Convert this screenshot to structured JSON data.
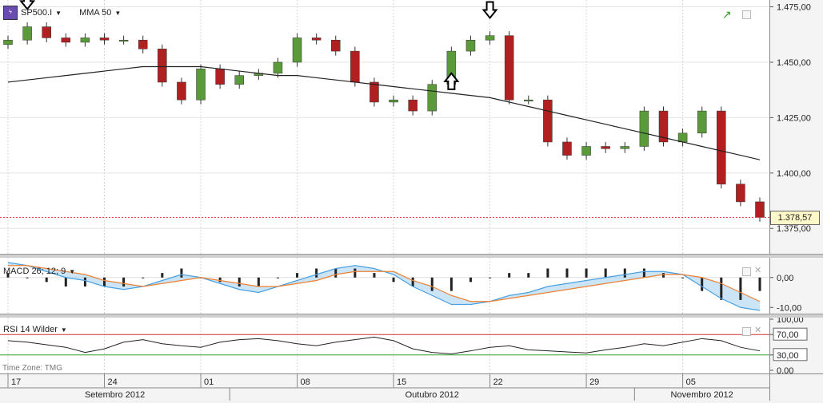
{
  "main_chart": {
    "symbol": "SP500.I",
    "indicator": "MMA 50",
    "last_price_label": "1.378,57",
    "y_ticks": [
      "1.475,00",
      "1.450,00",
      "1.425,00",
      "1.400,00",
      "1.375,00"
    ]
  },
  "macd": {
    "label": "MACD 26; 12; 9",
    "y_ticks": [
      "0,00",
      "-10,00"
    ]
  },
  "rsi": {
    "label": "RSI 14 Wilder",
    "y_ticks": [
      "100,00",
      "70,00",
      "30,00",
      "0,00"
    ]
  },
  "timezone_label": "Time Zone: TMG",
  "date_axis": {
    "day_ticks": [
      "17",
      "24",
      "01",
      "08",
      "15",
      "22",
      "29",
      "05"
    ],
    "months": [
      "Setembro 2012",
      "Outubro 2012",
      "Novembro 2012"
    ]
  },
  "colors": {
    "up_candle": "#5a9a3a",
    "down_candle": "#b02020",
    "ma_line": "#222222",
    "macd_line": "#4aa0e0",
    "signal_line": "#f08030",
    "rsi_upper": "#d03030",
    "rsi_lower": "#30a030",
    "last_price_line": "#e03030"
  },
  "icons": [
    "chart-symbol-icon",
    "trend-icon",
    "arrow-down-marker-icon",
    "arrow-up-marker-icon"
  ],
  "chart_data": [
    {
      "type": "candlestick",
      "title": "SP500.I",
      "overlay": "MMA 50",
      "ylim": [
        1365,
        1477
      ],
      "annotations": [
        {
          "type": "arrow-down",
          "date": "2012-09-14"
        },
        {
          "type": "arrow-up",
          "date": "2012-10-16"
        },
        {
          "type": "arrow-down",
          "date": "2012-10-18"
        }
      ],
      "x": [
        "2012-09-13",
        "2012-09-14",
        "2012-09-17",
        "2012-09-18",
        "2012-09-19",
        "2012-09-20",
        "2012-09-21",
        "2012-09-24",
        "2012-09-25",
        "2012-09-26",
        "2012-09-27",
        "2012-09-28",
        "2012-10-01",
        "2012-10-02",
        "2012-10-03",
        "2012-10-04",
        "2012-10-05",
        "2012-10-08",
        "2012-10-09",
        "2012-10-10",
        "2012-10-11",
        "2012-10-12",
        "2012-10-15",
        "2012-10-16",
        "2012-10-17",
        "2012-10-18",
        "2012-10-19",
        "2012-10-22",
        "2012-10-23",
        "2012-10-24",
        "2012-10-25",
        "2012-10-26",
        "2012-10-31",
        "2012-11-01",
        "2012-11-02",
        "2012-11-05",
        "2012-11-06",
        "2012-11-07",
        "2012-11-08",
        "2012-11-09"
      ],
      "close": [
        1460,
        1466,
        1461,
        1459,
        1461,
        1460,
        1460,
        1456,
        1441,
        1433,
        1447,
        1440,
        1444,
        1445,
        1450,
        1461,
        1460,
        1455,
        1441,
        1432,
        1433,
        1428,
        1440,
        1455,
        1460,
        1462,
        1433,
        1433,
        1414,
        1408,
        1412,
        1411,
        1412,
        1428,
        1414,
        1418,
        1428,
        1395,
        1387,
        1380
      ],
      "ma50": [
        1441,
        1442,
        1443,
        1444,
        1445,
        1446,
        1447,
        1448,
        1448,
        1448,
        1448,
        1447,
        1446,
        1445,
        1444,
        1444,
        1443,
        1442,
        1441,
        1440,
        1439,
        1438,
        1437,
        1436,
        1435,
        1434,
        1432,
        1430,
        1428,
        1426,
        1424,
        1422,
        1420,
        1418,
        1416,
        1414,
        1412,
        1410,
        1408,
        1406
      ]
    },
    {
      "type": "line",
      "title": "MACD 26; 12; 9",
      "ylim": [
        -11,
        5
      ],
      "series": [
        {
          "name": "MACD",
          "values": [
            5,
            4,
            2,
            0,
            -1,
            -3,
            -4,
            -3,
            -1,
            1,
            0,
            -2,
            -4,
            -5,
            -3,
            -1,
            1,
            3,
            4,
            3,
            1,
            -3,
            -6,
            -9,
            -9,
            -8,
            -6,
            -5,
            -3,
            -2,
            -1,
            0,
            1,
            2,
            2,
            1,
            -3,
            -7,
            -10,
            -11
          ]
        },
        {
          "name": "Signal",
          "values": [
            4,
            4,
            3,
            2,
            1,
            -1,
            -2,
            -3,
            -2,
            -1,
            0,
            -1,
            -2,
            -3,
            -3,
            -2,
            -1,
            1,
            2,
            2,
            2,
            -1,
            -3,
            -6,
            -8,
            -8,
            -7,
            -6,
            -5,
            -4,
            -3,
            -2,
            -1,
            0,
            1,
            1,
            0,
            -2,
            -5,
            -8
          ]
        }
      ]
    },
    {
      "type": "line",
      "title": "RSI 14 Wilder",
      "ylim": [
        0,
        100
      ],
      "reference_lines": [
        70,
        30
      ],
      "series": [
        {
          "name": "RSI",
          "values": [
            58,
            55,
            50,
            45,
            35,
            42,
            55,
            60,
            52,
            48,
            45,
            55,
            60,
            62,
            58,
            52,
            48,
            55,
            60,
            65,
            58,
            42,
            35,
            32,
            38,
            45,
            48,
            40,
            38,
            36,
            34,
            40,
            45,
            52,
            48,
            55,
            62,
            58,
            45,
            38
          ]
        }
      ]
    }
  ]
}
